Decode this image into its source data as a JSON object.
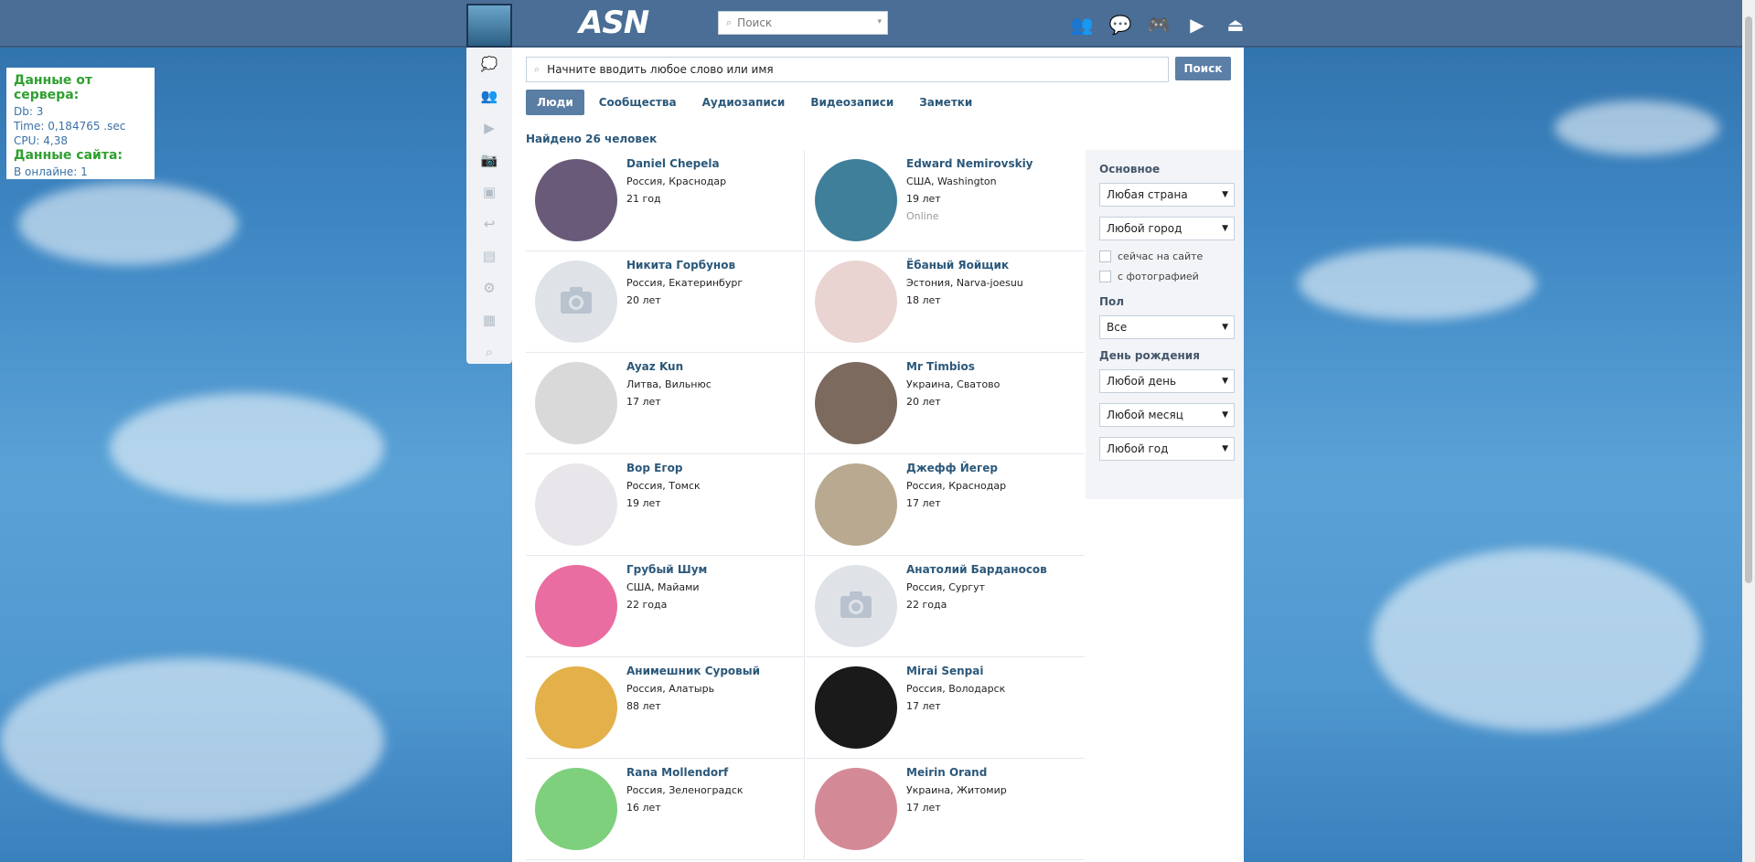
{
  "header": {
    "logo": "ASN",
    "search_placeholder": "Поиск",
    "icons": [
      "friends-icon",
      "messages-icon",
      "games-icon",
      "play-icon",
      "logout-icon"
    ]
  },
  "sidemenu": {
    "icons": [
      "chat-icon",
      "groups-icon",
      "video-icon",
      "camera-icon",
      "contacts-icon",
      "reply-icon",
      "news-icon",
      "settings-icon",
      "apps-icon",
      "search-book-icon"
    ]
  },
  "server_box": {
    "server_title": "Данные от сервера:",
    "db": "Db: 3",
    "time": "Time: 0,184765 .sec",
    "cpu": "CPU: 4,38",
    "site_title": "Данные сайта:",
    "online": "В онлайне: 1"
  },
  "search": {
    "placeholder": "Начните вводить любое слово или имя",
    "button": "Поиск"
  },
  "tabs": [
    {
      "label": "Люди",
      "active": true
    },
    {
      "label": "Сообщества",
      "active": false
    },
    {
      "label": "Аудиозаписи",
      "active": false
    },
    {
      "label": "Видеозаписи",
      "active": false
    },
    {
      "label": "Заметки",
      "active": false
    }
  ],
  "found_text": "Найдено 26 человек",
  "people": [
    {
      "name": "Daniel Chepela",
      "location": "Россия, Краснодар",
      "age": "21 год",
      "online": "",
      "avatar_color": "#6a5a7a"
    },
    {
      "name": "Edward Nemirovskiy",
      "location": "США, Washington",
      "age": "19 лет",
      "online": "Online",
      "avatar_color": "#3f7f9a"
    },
    {
      "name": "Никита Горбунов",
      "location": "Россия, Екатеринбург",
      "age": "20 лет",
      "online": "",
      "avatar_color": "#dfe3e8"
    },
    {
      "name": "Ёбаный Яойщик",
      "location": "Эстония, Narva-joesuu",
      "age": "18 лет",
      "online": "",
      "avatar_color": "#e9d4d2"
    },
    {
      "name": "Ayaz Kun",
      "location": "Литва, Вильнюс",
      "age": "17 лет",
      "online": "",
      "avatar_color": "#d9d9d9"
    },
    {
      "name": "Mr Timbios",
      "location": "Украина, Сватово",
      "age": "20 лет",
      "online": "",
      "avatar_color": "#7c6a5f"
    },
    {
      "name": "Вор Егор",
      "location": "Россия, Томск",
      "age": "19 лет",
      "online": "",
      "avatar_color": "#e8e6ea"
    },
    {
      "name": "Джефф Йегер",
      "location": "Россия, Краснодар",
      "age": "17 лет",
      "online": "",
      "avatar_color": "#b8a990"
    },
    {
      "name": "Грубый Шум",
      "location": "США, Майами",
      "age": "22 года",
      "online": "",
      "avatar_color": "#e96da0"
    },
    {
      "name": "Анатолий Барданосов",
      "location": "Россия, Сургут",
      "age": "22 года",
      "online": "",
      "avatar_color": "#dfe3e8"
    },
    {
      "name": "Анимешник Суровый",
      "location": "Россия, Алатырь",
      "age": "88 лет",
      "online": "",
      "avatar_color": "#e3b04a"
    },
    {
      "name": "Mirai Senpai",
      "location": "Россия, Володарск",
      "age": "17 лет",
      "online": "",
      "avatar_color": "#1a1a1a"
    },
    {
      "name": "Rana Mollendorf",
      "location": "Россия, Зеленоградск",
      "age": "16 лет",
      "online": "",
      "avatar_color": "#7ed07c"
    },
    {
      "name": "Meirin Orand",
      "location": "Украина, Житомир",
      "age": "17 лет",
      "online": "",
      "avatar_color": "#d48a96"
    }
  ],
  "filters": {
    "basic_title": "Основное",
    "country": "Любая страна",
    "city": "Любой город",
    "online_label": "сейчас на сайте",
    "photo_label": "с фотографией",
    "sex_title": "Пол",
    "sex": "Все",
    "birthday_title": "День рождения",
    "day": "Любой день",
    "month": "Любой месяц",
    "year": "Любой год"
  }
}
